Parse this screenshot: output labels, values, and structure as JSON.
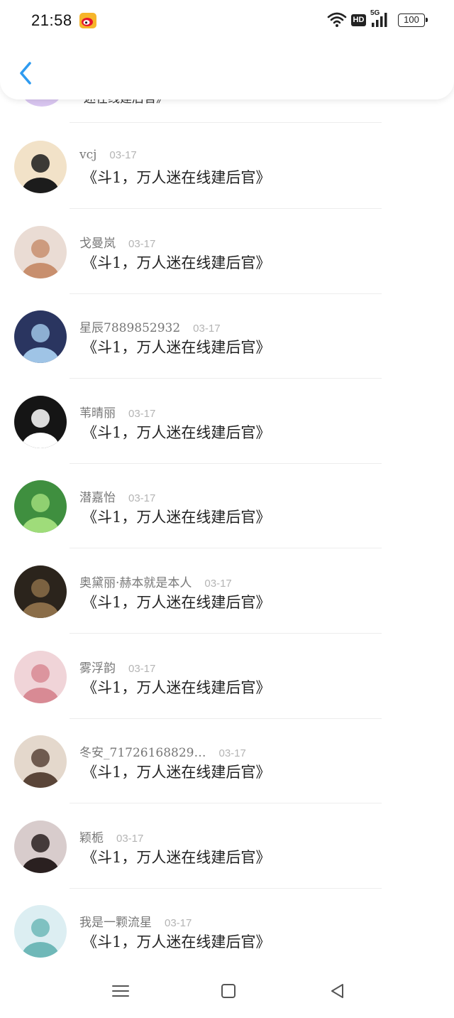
{
  "status_bar": {
    "time": "21:58",
    "notification_icon": "weibo-icon",
    "hd_label": "HD",
    "network_label": "5G",
    "battery": "100"
  },
  "header": {
    "back_icon": "chevron-left-icon"
  },
  "partial_top_row": {
    "text": "迷在线建后官》"
  },
  "comments": [
    {
      "username": "vcj",
      "date": "03-17",
      "content": "《斗1，万人迷在线建后官》",
      "avatar": {
        "bg": "#f2e2c8",
        "fg": "#1c1c1c"
      }
    },
    {
      "username": "戈曼岚",
      "date": "03-17",
      "content": "《斗1，万人迷在线建后官》",
      "avatar": {
        "bg": "#eadcd4",
        "fg": "#c88f6e"
      }
    },
    {
      "username": "星辰7889852932",
      "date": "03-17",
      "content": "《斗1，万人迷在线建后官》",
      "avatar": {
        "bg": "#2a3560",
        "fg": "#9fc4e6"
      }
    },
    {
      "username": "苇晴丽",
      "date": "03-17",
      "content": "《斗1，万人迷在线建后官》",
      "avatar": {
        "bg": "#151515",
        "fg": "#ffffff"
      }
    },
    {
      "username": "潜嘉怡",
      "date": "03-17",
      "content": "《斗1，万人迷在线建后官》",
      "avatar": {
        "bg": "#3f8f3f",
        "fg": "#9fdc7a"
      }
    },
    {
      "username": "奥黛丽·赫本就是本人",
      "date": "03-17",
      "content": "《斗1，万人迷在线建后官》",
      "avatar": {
        "bg": "#2b241c",
        "fg": "#8a6d48"
      }
    },
    {
      "username": "雾浮韵",
      "date": "03-17",
      "content": "《斗1，万人迷在线建后官》",
      "avatar": {
        "bg": "#f0d4d8",
        "fg": "#d88a94"
      }
    },
    {
      "username": "冬安_71726168829…",
      "date": "03-17",
      "content": "《斗1，万人迷在线建后官》",
      "avatar": {
        "bg": "#e4d8cc",
        "fg": "#5a4538"
      }
    },
    {
      "username": "颖栀",
      "date": "03-17",
      "content": "《斗1，万人迷在线建后官》",
      "avatar": {
        "bg": "#d8cccc",
        "fg": "#2a2020"
      }
    },
    {
      "username": "我是一颗流星",
      "date": "03-17",
      "content": "《斗1，万人迷在线建后官》",
      "avatar": {
        "bg": "#dceef2",
        "fg": "#6fb8b8"
      }
    }
  ],
  "nav_bar": {
    "menu_icon": "menu-icon",
    "home_icon": "home-square-icon",
    "back_icon": "back-triangle-icon"
  },
  "colors": {
    "accent": "#2e9bf0",
    "username": "#777777",
    "date": "#b4b4b4",
    "content": "#222222"
  }
}
